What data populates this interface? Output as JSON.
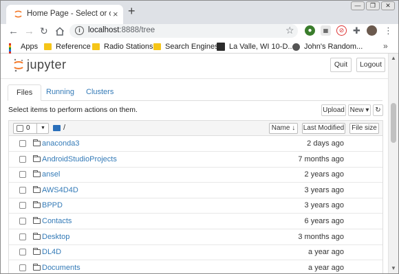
{
  "browser": {
    "tab_title": "Home Page - Select or create",
    "tab_close": "×",
    "new_tab": "+",
    "window_controls": [
      "—",
      "❐",
      "✕"
    ],
    "url_host": "localhost",
    "url_path": ":8888/tree",
    "bookmarks": [
      {
        "label": "Apps",
        "icon": "apps-icon"
      },
      {
        "label": "Reference",
        "icon": "folder-icon"
      },
      {
        "label": "Radio Stations",
        "icon": "folder-icon"
      },
      {
        "label": "Search Engines",
        "icon": "folder-icon"
      },
      {
        "label": "La Valle, WI 10-D...",
        "icon": "weather-icon"
      },
      {
        "label": "John's Random...",
        "icon": "globe-icon"
      }
    ],
    "bookmarks_more": "»"
  },
  "jupyter": {
    "logo_text": "jupyter",
    "quit_label": "Quit",
    "logout_label": "Logout",
    "tabs": [
      "Files",
      "Running",
      "Clusters"
    ],
    "select_message": "Select items to perform actions on them.",
    "upload_label": "Upload",
    "new_label": "New ▾",
    "refresh_icon": "↻",
    "selected_count": "0",
    "breadcrumb": "/",
    "sort_name_label": "Name ↓",
    "last_modified_label": "Last Modified",
    "file_size_label": "File size",
    "files": [
      {
        "name": "anaconda3",
        "modified": "2 days ago"
      },
      {
        "name": "AndroidStudioProjects",
        "modified": "7 months ago"
      },
      {
        "name": "ansel",
        "modified": "2 years ago"
      },
      {
        "name": "AWS4D4D",
        "modified": "3 years ago"
      },
      {
        "name": "BPPD",
        "modified": "3 years ago"
      },
      {
        "name": "Contacts",
        "modified": "6 years ago"
      },
      {
        "name": "Desktop",
        "modified": "3 months ago"
      },
      {
        "name": "DL4D",
        "modified": "a year ago"
      },
      {
        "name": "Documents",
        "modified": "a year ago"
      }
    ]
  },
  "colors": {
    "link": "#337ab7",
    "jupyter_orange": "#f37726",
    "chrome_tabstrip": "#dee1e6"
  }
}
